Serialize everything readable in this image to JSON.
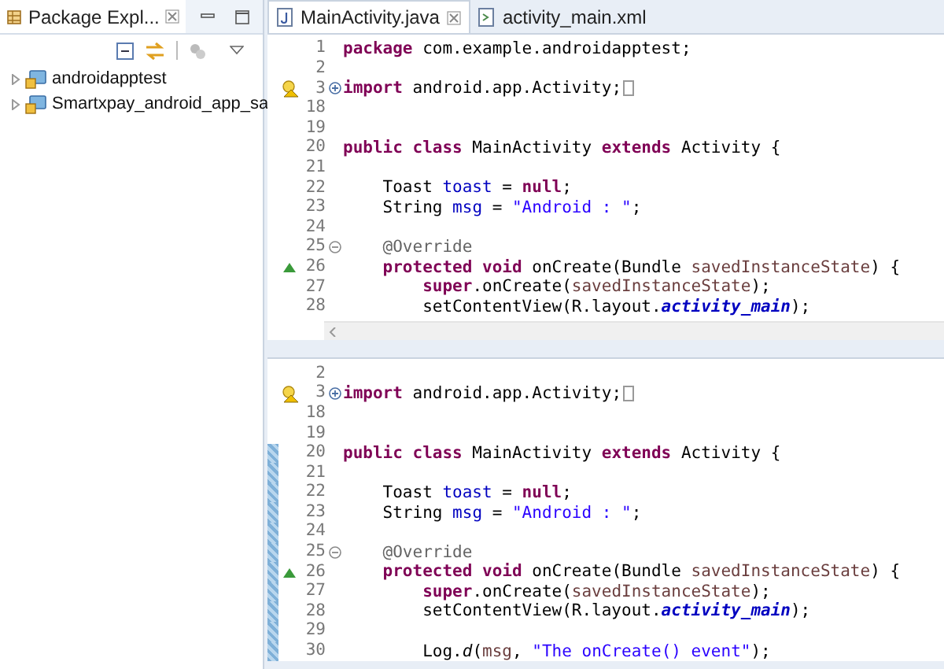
{
  "package_explorer": {
    "tab": {
      "label": "Package Expl...",
      "selected": true
    },
    "tree": [
      {
        "label": "androidapptest",
        "expanded": false
      },
      {
        "label": "Smartxpay_android_app_sa",
        "expanded": false
      }
    ]
  },
  "editor_tabs": [
    {
      "label": "MainActivity.java",
      "selected": true,
      "kind": "java"
    },
    {
      "label": "activity_main.xml",
      "selected": false,
      "kind": "xml"
    }
  ],
  "panes": [
    {
      "scrollbar": true,
      "lines": [
        {
          "number": "1",
          "segments": [
            {
              "kind": "keyword",
              "text": "package"
            },
            {
              "kind": "plain",
              "text": " com.example.androidapptest;"
            }
          ]
        },
        {
          "number": "2"
        },
        {
          "number": "3",
          "warning": true,
          "collapsed": true,
          "segments": [
            {
              "kind": "keyword",
              "text": "import"
            },
            {
              "kind": "plain",
              "text": " android.app.Activity;"
            }
          ]
        },
        {
          "number": "18"
        },
        {
          "number": "19"
        },
        {
          "number": "20",
          "segments": [
            {
              "kind": "keyword",
              "text": "public class"
            },
            {
              "kind": "plain",
              "text": " MainActivity "
            },
            {
              "kind": "keyword",
              "text": "extends"
            },
            {
              "kind": "plain",
              "text": " Activity {"
            }
          ]
        },
        {
          "number": "21"
        },
        {
          "number": "22",
          "segments": [
            {
              "kind": "plain",
              "text": "    Toast "
            },
            {
              "kind": "field",
              "text": "toast"
            },
            {
              "kind": "plain",
              "text": " = "
            },
            {
              "kind": "keyword",
              "text": "null"
            },
            {
              "kind": "plain",
              "text": ";"
            }
          ]
        },
        {
          "number": "23",
          "segments": [
            {
              "kind": "plain",
              "text": "    String "
            },
            {
              "kind": "field",
              "text": "msg"
            },
            {
              "kind": "plain",
              "text": " = "
            },
            {
              "kind": "string",
              "text": "\"Android : \""
            },
            {
              "kind": "plain",
              "text": ";"
            }
          ]
        },
        {
          "number": "24"
        },
        {
          "number": "25",
          "collapsed": false,
          "segments": [
            {
              "kind": "annotation",
              "text": "    @Override"
            }
          ]
        },
        {
          "number": "26",
          "override": true,
          "segments": [
            {
              "kind": "keyword",
              "text": "    protected void"
            },
            {
              "kind": "plain",
              "text": " onCreate(Bundle "
            },
            {
              "kind": "param",
              "text": "savedInstanceState"
            },
            {
              "kind": "plain",
              "text": ") {"
            }
          ]
        },
        {
          "number": "27",
          "segments": [
            {
              "kind": "keyword",
              "text": "        super"
            },
            {
              "kind": "plain",
              "text": ".onCreate("
            },
            {
              "kind": "param",
              "text": "savedInstanceState"
            },
            {
              "kind": "plain",
              "text": ");"
            }
          ]
        },
        {
          "number": "28",
          "segments": [
            {
              "kind": "plain",
              "text": "        setContentView(R.layout."
            },
            {
              "kind": "static_field",
              "text": "activity_main"
            },
            {
              "kind": "plain",
              "text": ");"
            }
          ]
        }
      ]
    },
    {
      "lines": [
        {
          "number": "2"
        },
        {
          "number": "3",
          "warning": true,
          "collapsed": true,
          "segments": [
            {
              "kind": "keyword",
              "text": "import"
            },
            {
              "kind": "plain",
              "text": " android.app.Activity;"
            }
          ]
        },
        {
          "number": "18"
        },
        {
          "number": "19"
        },
        {
          "number": "20",
          "changed": true,
          "segments": [
            {
              "kind": "keyword",
              "text": "public class"
            },
            {
              "kind": "plain",
              "text": " MainActivity "
            },
            {
              "kind": "keyword",
              "text": "extends"
            },
            {
              "kind": "plain",
              "text": " Activity {"
            }
          ]
        },
        {
          "number": "21",
          "changed": true
        },
        {
          "number": "22",
          "changed": true,
          "segments": [
            {
              "kind": "plain",
              "text": "    Toast "
            },
            {
              "kind": "field",
              "text": "toast"
            },
            {
              "kind": "plain",
              "text": " = "
            },
            {
              "kind": "keyword",
              "text": "null"
            },
            {
              "kind": "plain",
              "text": ";"
            }
          ]
        },
        {
          "number": "23",
          "changed": true,
          "segments": [
            {
              "kind": "plain",
              "text": "    String "
            },
            {
              "kind": "field",
              "text": "msg"
            },
            {
              "kind": "plain",
              "text": " = "
            },
            {
              "kind": "string",
              "text": "\"Android : \""
            },
            {
              "kind": "plain",
              "text": ";"
            }
          ]
        },
        {
          "number": "24",
          "changed": true
        },
        {
          "number": "25",
          "changed": true,
          "collapsed": false,
          "segments": [
            {
              "kind": "annotation",
              "text": "    @Override"
            }
          ]
        },
        {
          "number": "26",
          "changed": true,
          "override": true,
          "segments": [
            {
              "kind": "keyword",
              "text": "    protected void"
            },
            {
              "kind": "plain",
              "text": " onCreate(Bundle "
            },
            {
              "kind": "param",
              "text": "savedInstanceState"
            },
            {
              "kind": "plain",
              "text": ") {"
            }
          ]
        },
        {
          "number": "27",
          "changed": true,
          "segments": [
            {
              "kind": "keyword",
              "text": "        super"
            },
            {
              "kind": "plain",
              "text": ".onCreate("
            },
            {
              "kind": "param",
              "text": "savedInstanceState"
            },
            {
              "kind": "plain",
              "text": ");"
            }
          ]
        },
        {
          "number": "28",
          "changed": true,
          "segments": [
            {
              "kind": "plain",
              "text": "        setContentView(R.layout."
            },
            {
              "kind": "static_field",
              "text": "activity_main"
            },
            {
              "kind": "plain",
              "text": ");"
            }
          ]
        },
        {
          "number": "29",
          "changed": true
        },
        {
          "number": "30",
          "changed": true,
          "segments": [
            {
              "kind": "plain",
              "text": "        Log."
            },
            {
              "kind": "static_method",
              "text": "d"
            },
            {
              "kind": "plain",
              "text": "("
            },
            {
              "kind": "param",
              "text": "msg"
            },
            {
              "kind": "plain",
              "text": ", "
            },
            {
              "kind": "string",
              "text": "\"The onCreate() event\""
            },
            {
              "kind": "plain",
              "text": ");"
            }
          ]
        }
      ]
    }
  ]
}
